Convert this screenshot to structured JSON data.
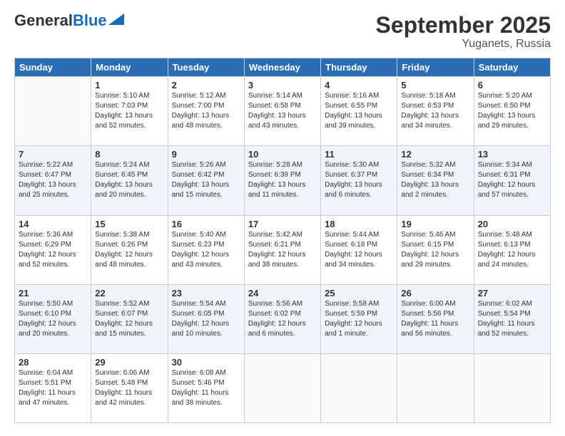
{
  "header": {
    "logo_general": "General",
    "logo_blue": "Blue",
    "main_title": "September 2025",
    "subtitle": "Yuganets, Russia"
  },
  "days_of_week": [
    "Sunday",
    "Monday",
    "Tuesday",
    "Wednesday",
    "Thursday",
    "Friday",
    "Saturday"
  ],
  "weeks": [
    [
      {
        "day": "",
        "info": ""
      },
      {
        "day": "1",
        "info": "Sunrise: 5:10 AM\nSunset: 7:03 PM\nDaylight: 13 hours\nand 52 minutes."
      },
      {
        "day": "2",
        "info": "Sunrise: 5:12 AM\nSunset: 7:00 PM\nDaylight: 13 hours\nand 48 minutes."
      },
      {
        "day": "3",
        "info": "Sunrise: 5:14 AM\nSunset: 6:58 PM\nDaylight: 13 hours\nand 43 minutes."
      },
      {
        "day": "4",
        "info": "Sunrise: 5:16 AM\nSunset: 6:55 PM\nDaylight: 13 hours\nand 39 minutes."
      },
      {
        "day": "5",
        "info": "Sunrise: 5:18 AM\nSunset: 6:53 PM\nDaylight: 13 hours\nand 34 minutes."
      },
      {
        "day": "6",
        "info": "Sunrise: 5:20 AM\nSunset: 6:50 PM\nDaylight: 13 hours\nand 29 minutes."
      }
    ],
    [
      {
        "day": "7",
        "info": "Sunrise: 5:22 AM\nSunset: 6:47 PM\nDaylight: 13 hours\nand 25 minutes."
      },
      {
        "day": "8",
        "info": "Sunrise: 5:24 AM\nSunset: 6:45 PM\nDaylight: 13 hours\nand 20 minutes."
      },
      {
        "day": "9",
        "info": "Sunrise: 5:26 AM\nSunset: 6:42 PM\nDaylight: 13 hours\nand 15 minutes."
      },
      {
        "day": "10",
        "info": "Sunrise: 5:28 AM\nSunset: 6:39 PM\nDaylight: 13 hours\nand 11 minutes."
      },
      {
        "day": "11",
        "info": "Sunrise: 5:30 AM\nSunset: 6:37 PM\nDaylight: 13 hours\nand 6 minutes."
      },
      {
        "day": "12",
        "info": "Sunrise: 5:32 AM\nSunset: 6:34 PM\nDaylight: 13 hours\nand 2 minutes."
      },
      {
        "day": "13",
        "info": "Sunrise: 5:34 AM\nSunset: 6:31 PM\nDaylight: 12 hours\nand 57 minutes."
      }
    ],
    [
      {
        "day": "14",
        "info": "Sunrise: 5:36 AM\nSunset: 6:29 PM\nDaylight: 12 hours\nand 52 minutes."
      },
      {
        "day": "15",
        "info": "Sunrise: 5:38 AM\nSunset: 6:26 PM\nDaylight: 12 hours\nand 48 minutes."
      },
      {
        "day": "16",
        "info": "Sunrise: 5:40 AM\nSunset: 6:23 PM\nDaylight: 12 hours\nand 43 minutes."
      },
      {
        "day": "17",
        "info": "Sunrise: 5:42 AM\nSunset: 6:21 PM\nDaylight: 12 hours\nand 38 minutes."
      },
      {
        "day": "18",
        "info": "Sunrise: 5:44 AM\nSunset: 6:18 PM\nDaylight: 12 hours\nand 34 minutes."
      },
      {
        "day": "19",
        "info": "Sunrise: 5:46 AM\nSunset: 6:15 PM\nDaylight: 12 hours\nand 29 minutes."
      },
      {
        "day": "20",
        "info": "Sunrise: 5:48 AM\nSunset: 6:13 PM\nDaylight: 12 hours\nand 24 minutes."
      }
    ],
    [
      {
        "day": "21",
        "info": "Sunrise: 5:50 AM\nSunset: 6:10 PM\nDaylight: 12 hours\nand 20 minutes."
      },
      {
        "day": "22",
        "info": "Sunrise: 5:52 AM\nSunset: 6:07 PM\nDaylight: 12 hours\nand 15 minutes."
      },
      {
        "day": "23",
        "info": "Sunrise: 5:54 AM\nSunset: 6:05 PM\nDaylight: 12 hours\nand 10 minutes."
      },
      {
        "day": "24",
        "info": "Sunrise: 5:56 AM\nSunset: 6:02 PM\nDaylight: 12 hours\nand 6 minutes."
      },
      {
        "day": "25",
        "info": "Sunrise: 5:58 AM\nSunset: 5:59 PM\nDaylight: 12 hours\nand 1 minute."
      },
      {
        "day": "26",
        "info": "Sunrise: 6:00 AM\nSunset: 5:56 PM\nDaylight: 11 hours\nand 56 minutes."
      },
      {
        "day": "27",
        "info": "Sunrise: 6:02 AM\nSunset: 5:54 PM\nDaylight: 11 hours\nand 52 minutes."
      }
    ],
    [
      {
        "day": "28",
        "info": "Sunrise: 6:04 AM\nSunset: 5:51 PM\nDaylight: 11 hours\nand 47 minutes."
      },
      {
        "day": "29",
        "info": "Sunrise: 6:06 AM\nSunset: 5:48 PM\nDaylight: 11 hours\nand 42 minutes."
      },
      {
        "day": "30",
        "info": "Sunrise: 6:08 AM\nSunset: 5:46 PM\nDaylight: 11 hours\nand 38 minutes."
      },
      {
        "day": "",
        "info": ""
      },
      {
        "day": "",
        "info": ""
      },
      {
        "day": "",
        "info": ""
      },
      {
        "day": "",
        "info": ""
      }
    ]
  ]
}
